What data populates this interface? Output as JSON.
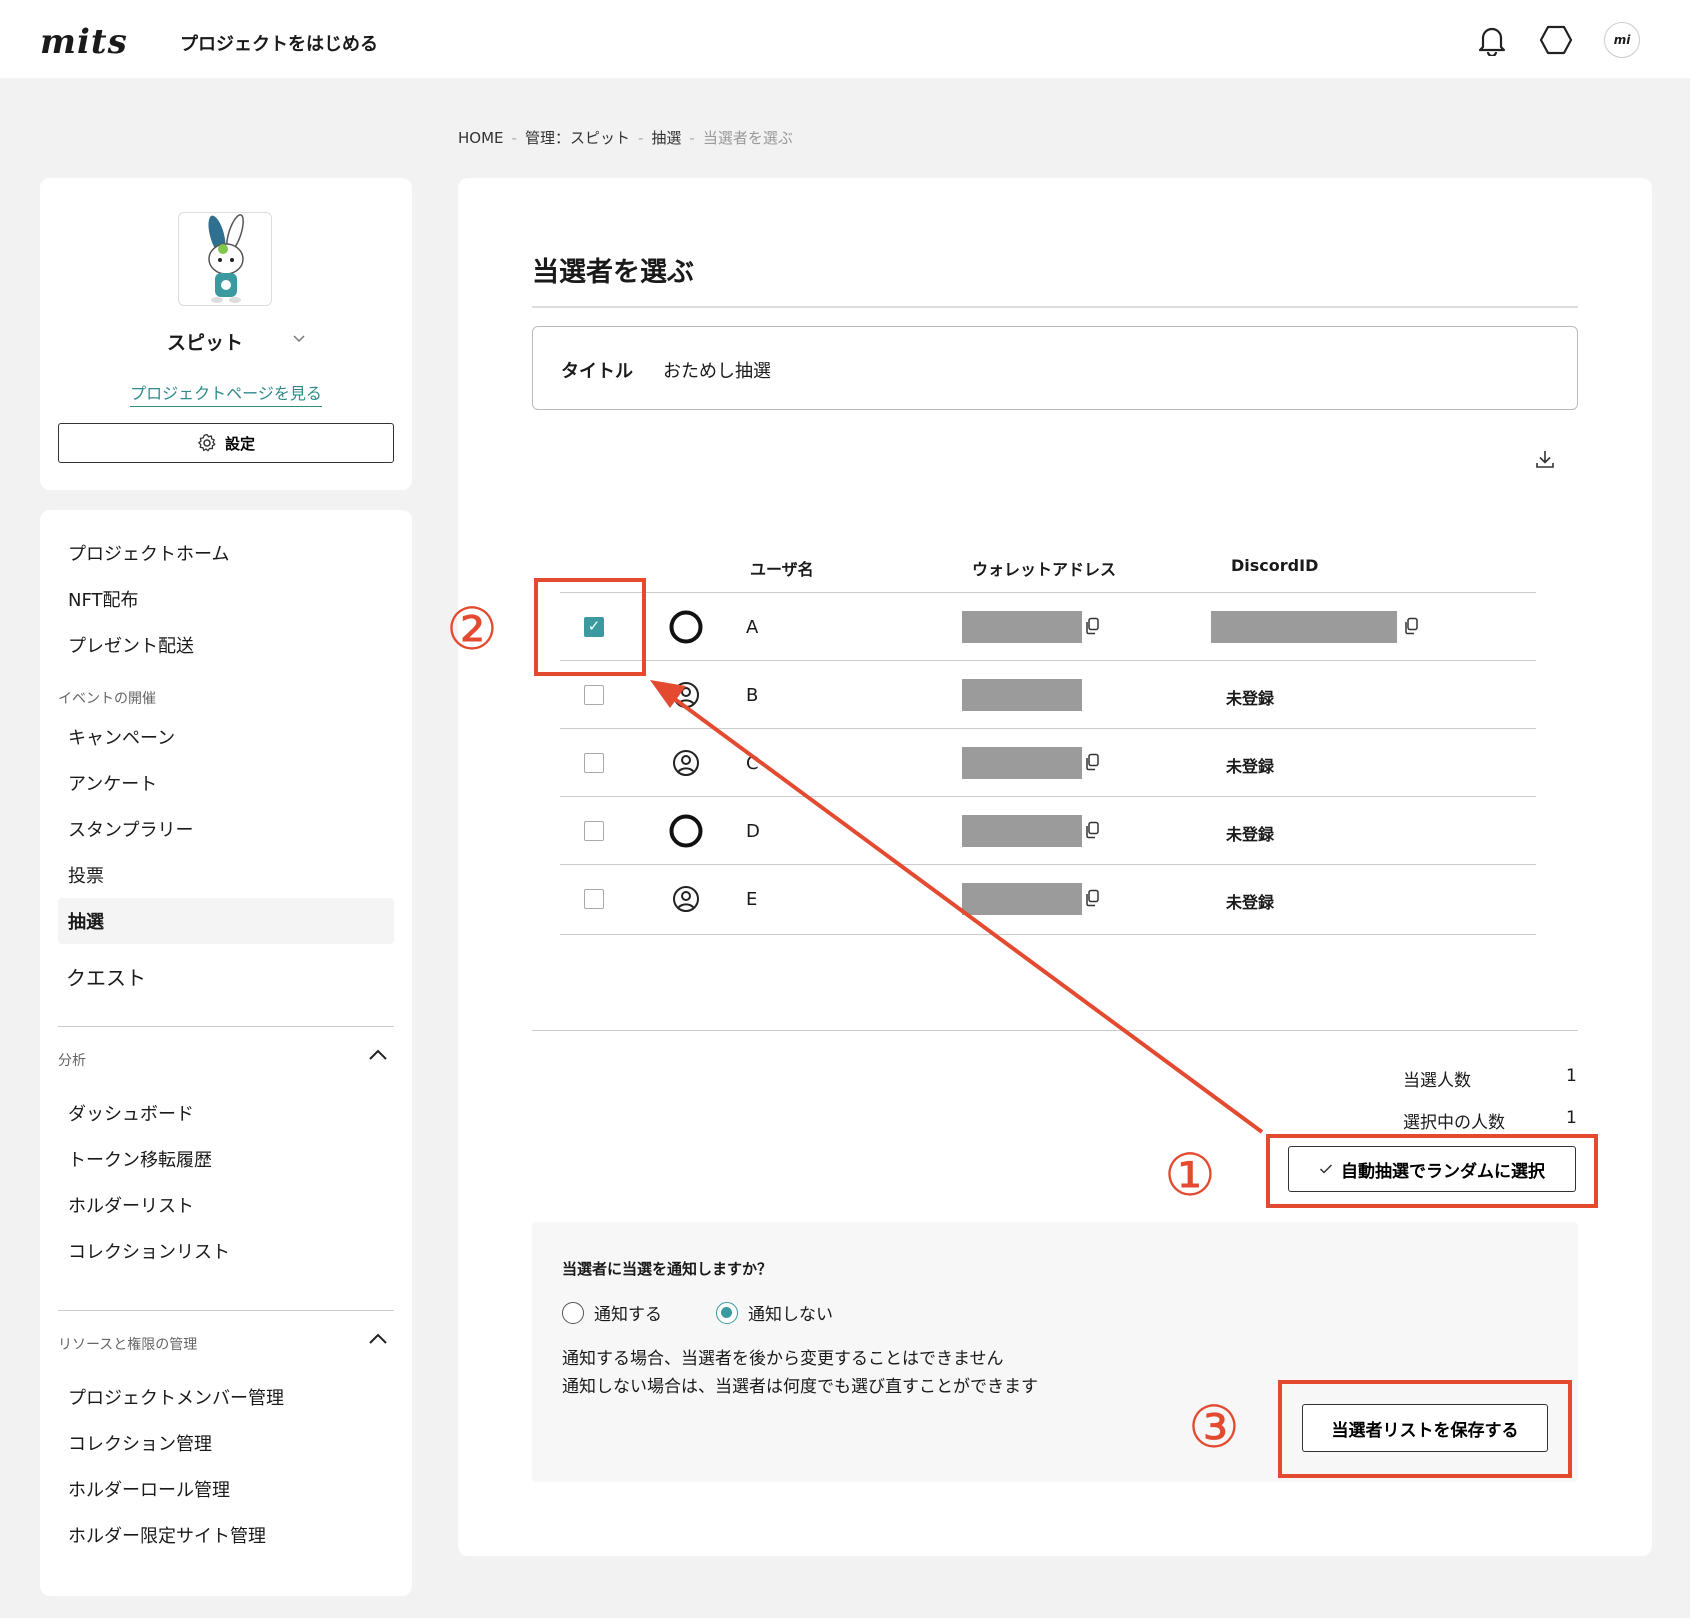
{
  "header": {
    "logo": "mits",
    "start_project": "プロジェクトをはじめる",
    "avatar_text": "mi"
  },
  "breadcrumb": [
    "HOME",
    "管理：スピット",
    "抽選",
    "当選者を選ぶ"
  ],
  "sidebar": {
    "project_name": "スピット",
    "project_link": "プロジェクトページを見る",
    "settings_label": "設定",
    "items": [
      "プロジェクトホーム",
      "NFT配布",
      "プレゼント配送"
    ],
    "event_section": "イベントの開催",
    "event_items": [
      "キャンペーン",
      "アンケート",
      "スタンプラリー",
      "投票",
      "抽選"
    ],
    "quest": "クエスト",
    "analysis_section": "分析",
    "analysis_items": [
      "ダッシュボード",
      "トークン移転履歴",
      "ホルダーリスト",
      "コレクションリスト"
    ],
    "resource_section": "リソースと権限の管理",
    "resource_items": [
      "プロジェクトメンバー管理",
      "コレクション管理",
      "ホルダーロール管理",
      "ホルダー限定サイト管理"
    ]
  },
  "main": {
    "title": "当選者を選ぶ",
    "lottery_title_label": "タイトル",
    "lottery_title_value": "おためし抽選",
    "columns": [
      "ユーザ名",
      "ウォレットアドレス",
      "DiscordID"
    ],
    "rows": [
      {
        "checked": true,
        "icon": "ring",
        "name": "A",
        "discord": ""
      },
      {
        "checked": false,
        "icon": "user-circle",
        "name": "B",
        "discord": "未登録"
      },
      {
        "checked": false,
        "icon": "user-circle",
        "name": "C",
        "discord": "未登録"
      },
      {
        "checked": false,
        "icon": "ring",
        "name": "D",
        "discord": "未登録"
      },
      {
        "checked": false,
        "icon": "user-circle",
        "name": "E",
        "discord": "未登録"
      }
    ],
    "winners_label": "当選人数",
    "winners_value": "1",
    "selected_label": "選択中の人数",
    "selected_value": "1",
    "auto_button": "自動抽選でランダムに選択",
    "notify_question": "当選者に当選を通知しますか？",
    "notify_yes": "通知する",
    "notify_no": "通知しない",
    "notify_selected": "通知しない",
    "note1": "通知する場合、当選者を後から変更することはできません",
    "note2": "通知しない場合は、当選者は何度でも選び直すことができます",
    "save_button": "当選者リストを保存する"
  },
  "annotations": {
    "n1": "①",
    "n2": "②",
    "n3": "③",
    "color": "#e34a2f"
  },
  "colors": {
    "accent": "#3a9a9f",
    "annotation": "#e34a2f",
    "redacted": "#9b9b9b"
  }
}
